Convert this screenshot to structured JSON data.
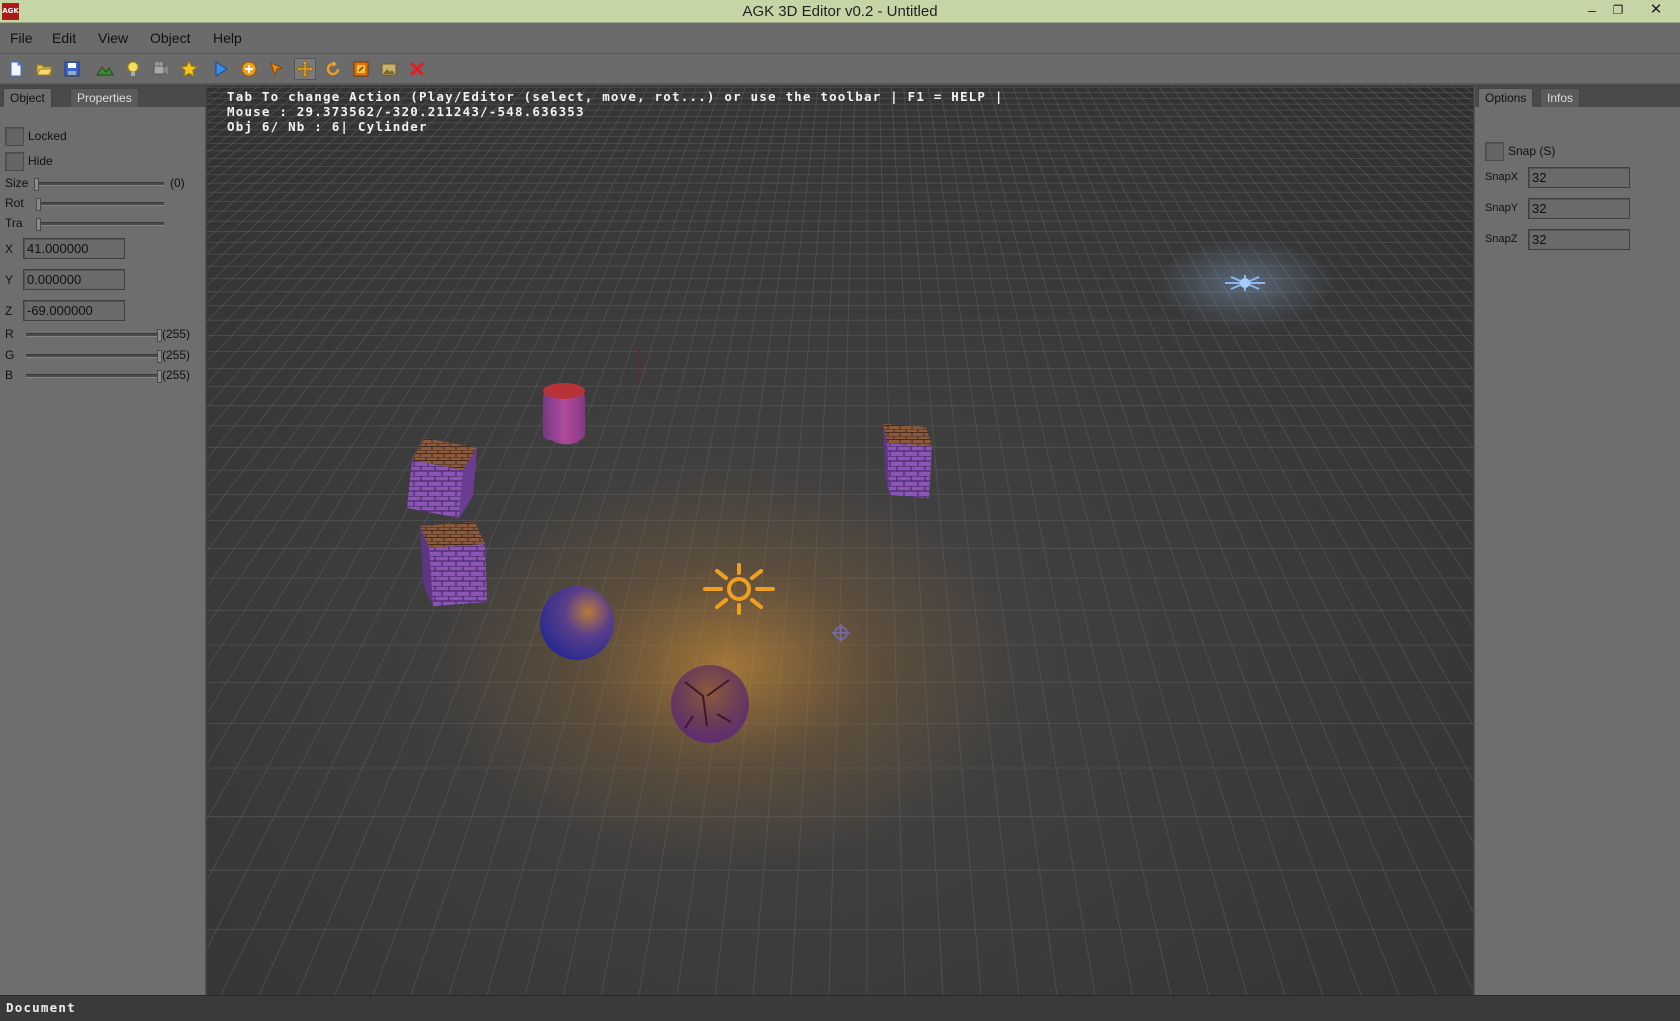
{
  "window": {
    "title": "AGK 3D Editor v0.2 - Untitled",
    "logo_text": "AGK"
  },
  "menu": [
    "File",
    "Edit",
    "View",
    "Object",
    "Help"
  ],
  "toolbar": {
    "icons": [
      "new-file-icon",
      "open-folder-icon",
      "save-icon",
      "terrain-icon",
      "light-bulb-icon",
      "camera-icon",
      "star-icon",
      "play-icon",
      "add-object-icon",
      "select-arrow-icon",
      "move-icon",
      "rotate-icon",
      "scale-icon",
      "image-icon",
      "delete-icon"
    ]
  },
  "left_panel": {
    "tabs": [
      "Object",
      "Properties"
    ],
    "active_tab": "Object",
    "locked_label": "Locked",
    "hide_label": "Hide",
    "size": {
      "label": "Size",
      "display": "(0)",
      "value": 0
    },
    "rot": {
      "label": "Rot",
      "value": 0
    },
    "tra": {
      "label": "Tra",
      "value": 0
    },
    "x": {
      "label": "X",
      "value": "41.000000"
    },
    "y": {
      "label": "Y",
      "value": "0.000000"
    },
    "z": {
      "label": "Z",
      "value": "-69.000000"
    },
    "r": {
      "label": "R",
      "display": "(255)",
      "value": 255
    },
    "g": {
      "label": "G",
      "display": "(255)",
      "value": 255
    },
    "b": {
      "label": "B",
      "display": "(255)",
      "value": 255
    }
  },
  "viewport": {
    "hud_line1": "Tab To change Action (Play/Editor (select, move, rot...) or use the toolbar | F1 = HELP |",
    "hud_line2": "Mouse : 29.373562/-320.211243/-548.636353",
    "hud_line3": "Obj 6/ Nb : 6| Cylinder"
  },
  "right_panel": {
    "tabs": [
      "Options",
      "Infos"
    ],
    "active_tab": "Options",
    "snap_label": "Snap  (S)",
    "snapx": {
      "label": "SnapX",
      "value": "32"
    },
    "snapy": {
      "label": "SnapY",
      "value": "32"
    },
    "snapz": {
      "label": "SnapZ",
      "value": "32"
    }
  },
  "status": {
    "text": "Document"
  },
  "colors": {
    "titlebar": "#c6d5a5",
    "panel": "#6e6e6e",
    "viewport": "#3a3a3a",
    "grid": "#5a5a5a",
    "light": "#f0a020"
  }
}
